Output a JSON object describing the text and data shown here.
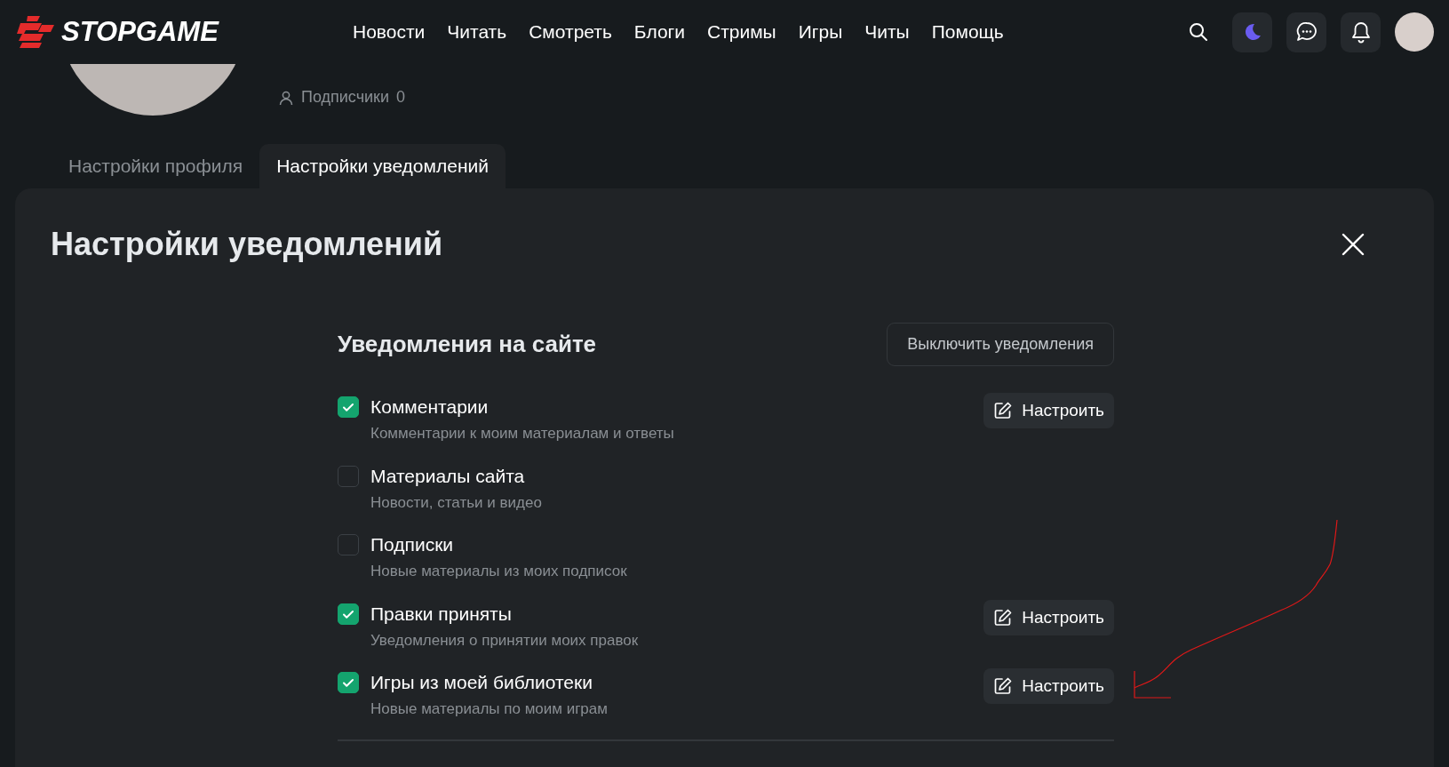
{
  "header": {
    "logo": "STOPGAME",
    "nav": [
      "Новости",
      "Читать",
      "Смотреть",
      "Блоги",
      "Стримы",
      "Игры",
      "Читы",
      "Помощь"
    ]
  },
  "profile": {
    "subscribers_label": "Подписчики",
    "subscribers_count": "0"
  },
  "tabs": [
    {
      "label": "Настройки профиля",
      "selected": false
    },
    {
      "label": "Настройки уведомлений",
      "selected": true
    }
  ],
  "panel": {
    "title": "Настройки уведомлений",
    "section_title": "Уведомления на сайте",
    "disable_button": "Выключить уведомления",
    "items": [
      {
        "title": "Комментарии",
        "description": "Комментарии к моим материалам и ответы",
        "checked": true,
        "configure": "Настроить"
      },
      {
        "title": "Материалы сайта",
        "description": "Новости, статьи и видео",
        "checked": false
      },
      {
        "title": "Подписки",
        "description": "Новые материалы из моих подписок",
        "checked": false
      },
      {
        "title": "Правки приняты",
        "description": "Уведомления о принятии моих правок",
        "checked": true,
        "configure": "Настроить"
      },
      {
        "title": "Игры из моей библиотеки",
        "description": "Новые материалы по моим играм",
        "checked": true,
        "configure": "Настроить"
      }
    ]
  }
}
